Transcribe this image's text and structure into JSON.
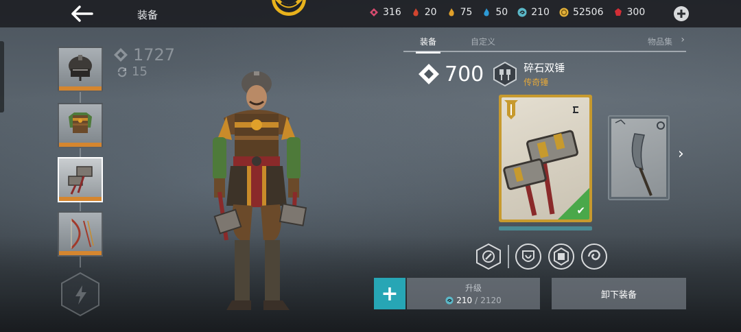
{
  "header": {
    "title": "装备",
    "currencies": [
      {
        "name": "gems-pink",
        "value": "316",
        "color": "#d64a6e"
      },
      {
        "name": "essence-red",
        "value": "20",
        "color": "#d2452f"
      },
      {
        "name": "essence-yellow",
        "value": "75",
        "color": "#e0a02a"
      },
      {
        "name": "essence-blue",
        "value": "50",
        "color": "#2d9ad6"
      },
      {
        "name": "upgrade-stones",
        "value": "210",
        "color": "#5bb8c8"
      },
      {
        "name": "coins",
        "value": "52506",
        "color": "#e3b13a"
      },
      {
        "name": "ruby",
        "value": "300",
        "color": "#d22e36"
      }
    ]
  },
  "loadout": {
    "power": "1727",
    "level": "15",
    "slots": [
      {
        "name": "helmet",
        "selected": false
      },
      {
        "name": "armor",
        "selected": false
      },
      {
        "name": "weapon",
        "selected": true
      },
      {
        "name": "ranged",
        "selected": false
      }
    ]
  },
  "tabs": {
    "equipment": "装备",
    "custom": "自定义",
    "collections": "物品集"
  },
  "item": {
    "power": "700",
    "name": "碎石双锤",
    "rarity": "传奇锤"
  },
  "actions": {
    "upgrade_label": "升级",
    "upgrade_have": "210",
    "upgrade_sep": "/",
    "upgrade_need": "2120",
    "unequip_label": "卸下装备"
  },
  "colors": {
    "accent_teal": "#27a6b5",
    "legendary_gold": "#c79a2e",
    "equipped_green": "#4aa84a",
    "rarity_text": "#e5a83a"
  }
}
